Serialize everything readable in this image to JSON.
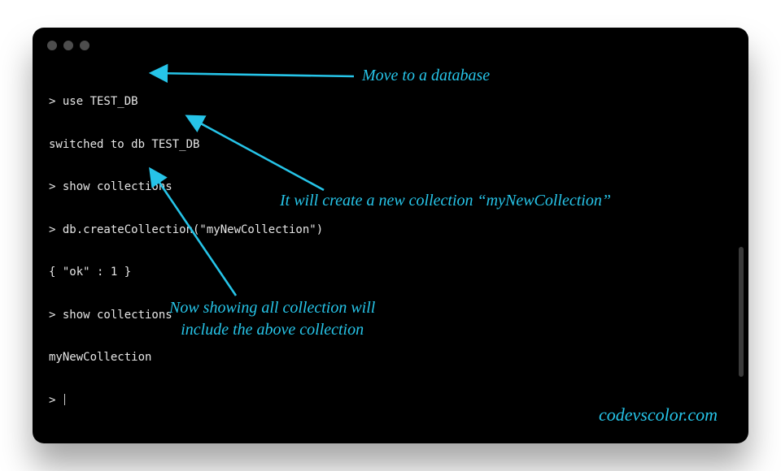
{
  "terminal": {
    "lines": [
      "> use TEST_DB",
      "switched to db TEST_DB",
      "> show collections",
      "> db.createCollection(\"myNewCollection\")",
      "{ \"ok\" : 1 }",
      "> show collections",
      "myNewCollection",
      "> "
    ]
  },
  "annotations": {
    "a1": "Move to a database",
    "a2": "It will create a new collection “myNewCollection”",
    "a3_line1": "Now showing all collection will",
    "a3_line2": "include the above collection"
  },
  "watermark": "codevscolor.com",
  "colors": {
    "accent": "#26c4e8",
    "terminal_bg": "#000000",
    "terminal_fg": "#e6e6e6"
  }
}
